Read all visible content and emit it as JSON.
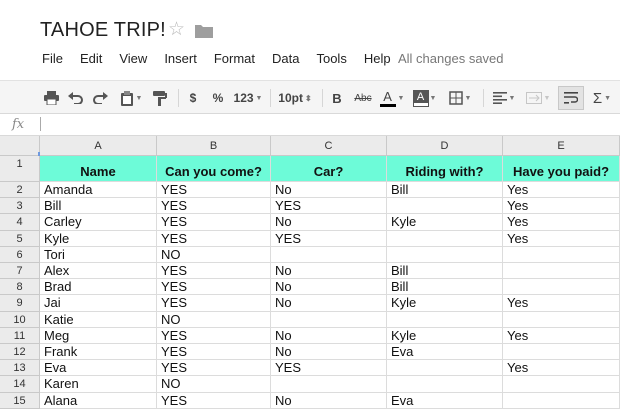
{
  "document": {
    "title": "TAHOE TRIP!",
    "save_status": "All changes saved"
  },
  "menu": [
    "File",
    "Edit",
    "View",
    "Insert",
    "Format",
    "Data",
    "Tools",
    "Help"
  ],
  "toolbar": {
    "currency_label": "$",
    "percent_label": "%",
    "number_format_label": "123",
    "font_size_label": "10pt",
    "bold_label": "B",
    "strikethrough_label": "Abc",
    "text_color_label": "A",
    "fill_color_label": "A",
    "sum_label": "Σ",
    "icons": [
      "print-icon",
      "undo-icon",
      "redo-icon",
      "paint-format-icon",
      "text-color-icon",
      "fill-color-icon",
      "borders-icon",
      "align-left-icon",
      "merge-cells-icon",
      "wrap-text-icon",
      "functions-icon"
    ]
  },
  "formula_bar": {
    "fx_label": "fx",
    "value": ""
  },
  "colors": {
    "header_fill": "#6dfbd8",
    "selection": "#6f9ae0"
  },
  "columns": [
    "A",
    "B",
    "C",
    "D",
    "E"
  ],
  "sheet": {
    "header_row": [
      "Name",
      "Can you come?",
      "Car?",
      "Riding with?",
      "Have you paid?"
    ],
    "rows": [
      [
        "Amanda",
        "YES",
        "No",
        "Bill",
        "Yes"
      ],
      [
        "Bill",
        "YES",
        "YES",
        "",
        "Yes"
      ],
      [
        "Carley",
        "YES",
        "No",
        "Kyle",
        "Yes"
      ],
      [
        "Kyle",
        "YES",
        "YES",
        "",
        "Yes"
      ],
      [
        "Tori",
        "NO",
        "",
        "",
        ""
      ],
      [
        "Alex",
        "YES",
        "No",
        "Bill",
        ""
      ],
      [
        "Brad",
        "YES",
        "No",
        "Bill",
        ""
      ],
      [
        "Jai",
        "YES",
        "No",
        "Kyle",
        "Yes"
      ],
      [
        "Katie",
        "NO",
        "",
        "",
        ""
      ],
      [
        "Meg",
        "YES",
        "No",
        "Kyle",
        "Yes"
      ],
      [
        "Frank",
        "YES",
        "No",
        "Eva",
        ""
      ],
      [
        "Eva",
        "YES",
        "YES",
        "",
        "Yes"
      ],
      [
        "Karen",
        "NO",
        "",
        "",
        ""
      ],
      [
        "Alana",
        "YES",
        "No",
        "Eva",
        ""
      ]
    ]
  }
}
